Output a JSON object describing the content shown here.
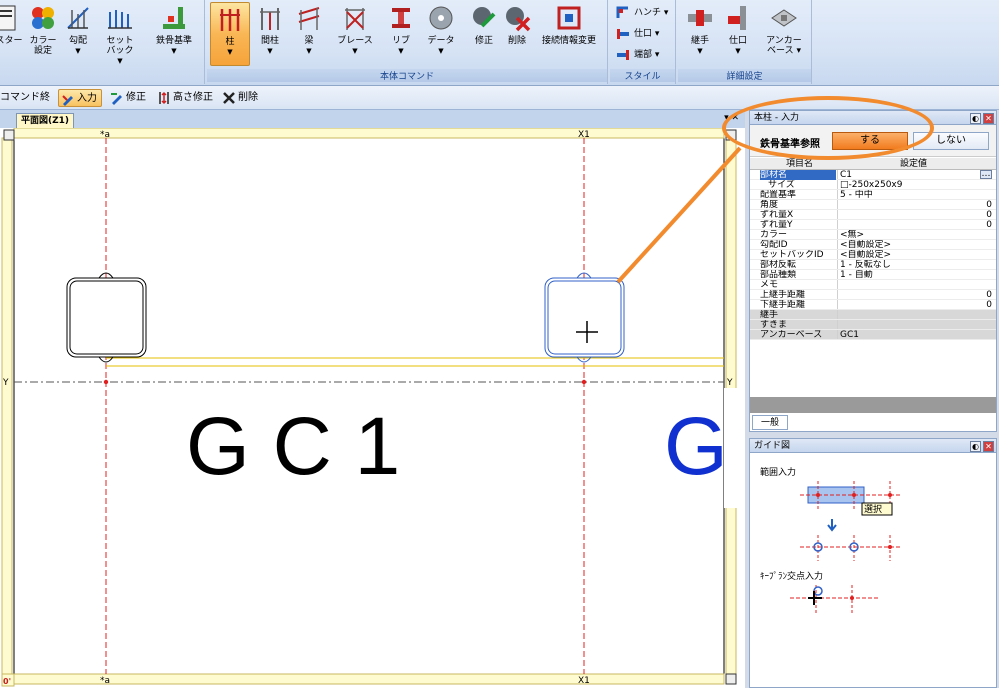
{
  "ribbon": {
    "group_main_label": "本体コマンド",
    "group_style_label": "スタイル",
    "group_detail_label": "詳細設定",
    "buttons": {
      "master": "スター",
      "color_l1": "カラー",
      "color_l2": "設定",
      "slope": "勾配",
      "setback_l1": "セット",
      "setback_l2": "バック",
      "steel_ref": "鉄骨基準",
      "column": "柱",
      "intercolumn": "間柱",
      "beam": "梁",
      "brace": "ブレース",
      "rib": "リブ",
      "data": "データ",
      "modify": "修正",
      "delete": "削除",
      "conn_change": "接続情報変更",
      "haunch": "ハンチ",
      "shiguchi": "仕口",
      "end": "端部",
      "joint": "継手",
      "shiguchi2": "仕口",
      "anchor_l1": "アンカー",
      "anchor_l2": "ベース"
    },
    "colors": {
      "accent_orange": "#f6a33a",
      "ribbon_blue": "#15428b"
    }
  },
  "cmdbar": {
    "end_cmd": "コマンド終了",
    "input": "入力",
    "modify": "修正",
    "height_modify": "高さ修正",
    "delete": "削除"
  },
  "doc": {
    "tab_label": "平面図(Z1)",
    "grid_top_left": "*a",
    "grid_top_right": "X1",
    "grid_bottom_left": "*a",
    "grid_bottom_right": "X1",
    "side_mark": "Y",
    "corner_mark": "0'",
    "column_label": "G C 1",
    "column_label_partial": "G"
  },
  "prop_panel": {
    "title": "本柱 - 入力",
    "ref_label": "鉄骨基準参照",
    "yes_label": "する",
    "no_label": "しない",
    "col_item": "項目名",
    "col_value": "設定値",
    "rows": [
      {
        "k": "部材名",
        "v": "C1",
        "extra": "…"
      },
      {
        "k": "サイズ",
        "v": "□-250x250x9"
      },
      {
        "k": "配置基準",
        "v": "5 - 中中"
      },
      {
        "k": "角度",
        "v": "",
        "r": "0"
      },
      {
        "k": "ずれ量X",
        "v": "",
        "r": "0"
      },
      {
        "k": "ずれ量Y",
        "v": "",
        "r": "0"
      },
      {
        "k": "カラー",
        "v": "<無>"
      },
      {
        "k": "勾配ID",
        "v": "<自動設定>"
      },
      {
        "k": "セットバックID",
        "v": "<自動設定>"
      },
      {
        "k": "部材反転",
        "v": "1 - 反転なし"
      },
      {
        "k": "部品種類",
        "v": "1 - 自動"
      },
      {
        "k": "メモ",
        "v": ""
      },
      {
        "k": "上継手距離",
        "v": "",
        "r": "0"
      },
      {
        "k": "下継手距離",
        "v": "",
        "r": "0"
      },
      {
        "k": "継手",
        "v": ""
      },
      {
        "k": "すきま",
        "v": ""
      },
      {
        "k": "アンカーベース",
        "v": "GC1"
      }
    ],
    "tab_label": "一般"
  },
  "guide_panel": {
    "title": "ガイド図",
    "range_input": "範囲入力",
    "select_label": "選択",
    "keyplan_input": "ｷｰﾌﾟﾗﾝ交点入力"
  }
}
